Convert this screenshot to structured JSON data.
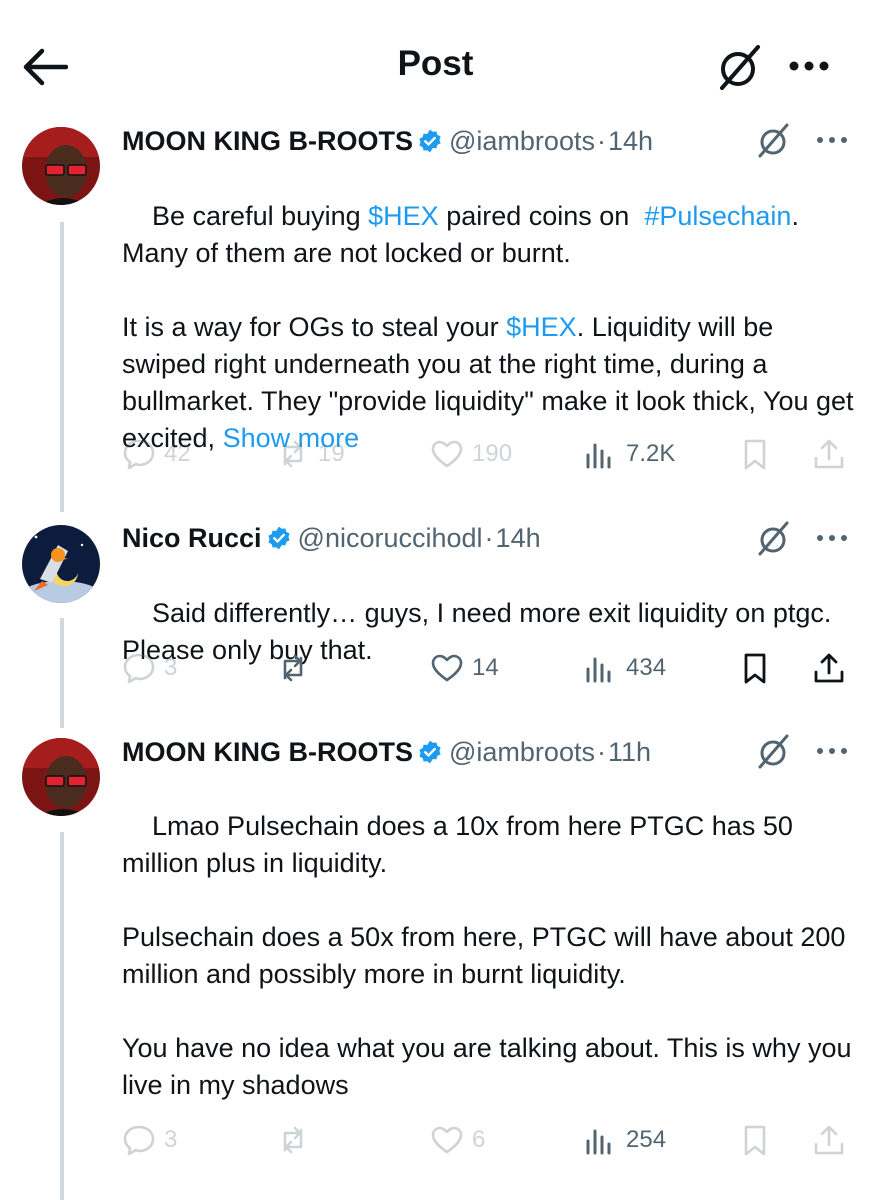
{
  "header": {
    "title": "Post"
  },
  "tweets": [
    {
      "name": "MOON KING B-ROOTS",
      "handle": "@iambroots",
      "sep": "·",
      "time": "14h",
      "text": [
        {
          "t": "Be careful buying "
        },
        {
          "t": "$HEX",
          "link": true
        },
        {
          "t": " paired coins on  "
        },
        {
          "t": "#Pulsechain",
          "link": true
        },
        {
          "t": ".\nMany of them are not locked or burnt.\n\nIt is a way for OGs to steal your "
        },
        {
          "t": "$HEX",
          "link": true
        },
        {
          "t": ". Liquidity will be swiped right underneath you at the right time, during a bullmarket. They \"provide liquidity\" make it look thick, You get excited, "
        },
        {
          "t": "Show more",
          "link": true
        }
      ],
      "replies": "42",
      "reposts": "19",
      "likes": "190",
      "views": "7.2K"
    },
    {
      "name": "Nico Rucci",
      "handle": "@nicoruccihodl",
      "sep": "·",
      "time": "14h",
      "text": [
        {
          "t": "Said differently… guys, I need more exit liquidity on ptgc. Please only buy that."
        }
      ],
      "replies": "3",
      "reposts": "",
      "likes": "14",
      "views": "434"
    },
    {
      "name": "MOON KING B-ROOTS",
      "handle": "@iambroots",
      "sep": "·",
      "time": "11h",
      "text": [
        {
          "t": "Lmao Pulsechain does a 10x from here PTGC has 50 million plus in liquidity.\n\nPulsechain does a 50x from here, PTGC will have about 200 million and possibly more in burnt liquidity.\n\nYou have no idea what you are talking about. This is why you live in my shadows"
        }
      ],
      "replies": "3",
      "reposts": "",
      "likes": "6",
      "views": "254"
    }
  ],
  "colors": {
    "link": "#1d9bf0",
    "muted": "#536471",
    "verified": "#1d9bf0",
    "thread": "#cfd9de"
  },
  "icons": [
    "back-arrow-icon",
    "grok-icon",
    "more-icon",
    "verified-icon",
    "reply-icon",
    "repost-icon",
    "like-icon",
    "views-icon",
    "bookmark-icon",
    "share-icon"
  ]
}
